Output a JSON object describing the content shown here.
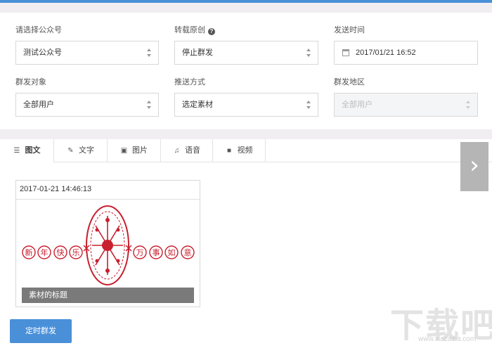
{
  "form": {
    "account": {
      "label": "请选择公众号",
      "value": "测试公众号"
    },
    "repost": {
      "label": "转载原创",
      "help_icon": "question-circle-icon",
      "value": "停止群发"
    },
    "send_time": {
      "label": "发送时间",
      "icon": "calendar-icon",
      "value": "2017/01/21 16:52"
    },
    "target": {
      "label": "群发对象",
      "value": "全部用户"
    },
    "push_method": {
      "label": "推送方式",
      "value": "选定素材"
    },
    "region": {
      "label": "群发地区",
      "value": "全部用户",
      "disabled": true
    }
  },
  "tabs": [
    {
      "label": "图文",
      "icon": "news-icon",
      "glyph": "☰",
      "active": true
    },
    {
      "label": "文字",
      "icon": "edit-icon",
      "glyph": "✎",
      "active": false
    },
    {
      "label": "图片",
      "icon": "image-icon",
      "glyph": "▣",
      "active": false
    },
    {
      "label": "语音",
      "icon": "music-icon",
      "glyph": "♫",
      "active": false
    },
    {
      "label": "视频",
      "icon": "video-icon",
      "glyph": "■",
      "active": false
    }
  ],
  "card": {
    "timestamp": "2017-01-21 14:46:13",
    "caption": "素材的标题",
    "image_chars": [
      "新",
      "年",
      "快",
      "乐",
      "万",
      "事",
      "如",
      "意"
    ]
  },
  "next_arrow": "›",
  "schedule_button": "定时群发",
  "watermark": {
    "main": "下载吧",
    "sub": "www.xiazaiba.com"
  },
  "colors": {
    "accent": "#4a90d9",
    "stamp_red": "#c8202f",
    "caption_bg": "#7a7a7a"
  }
}
